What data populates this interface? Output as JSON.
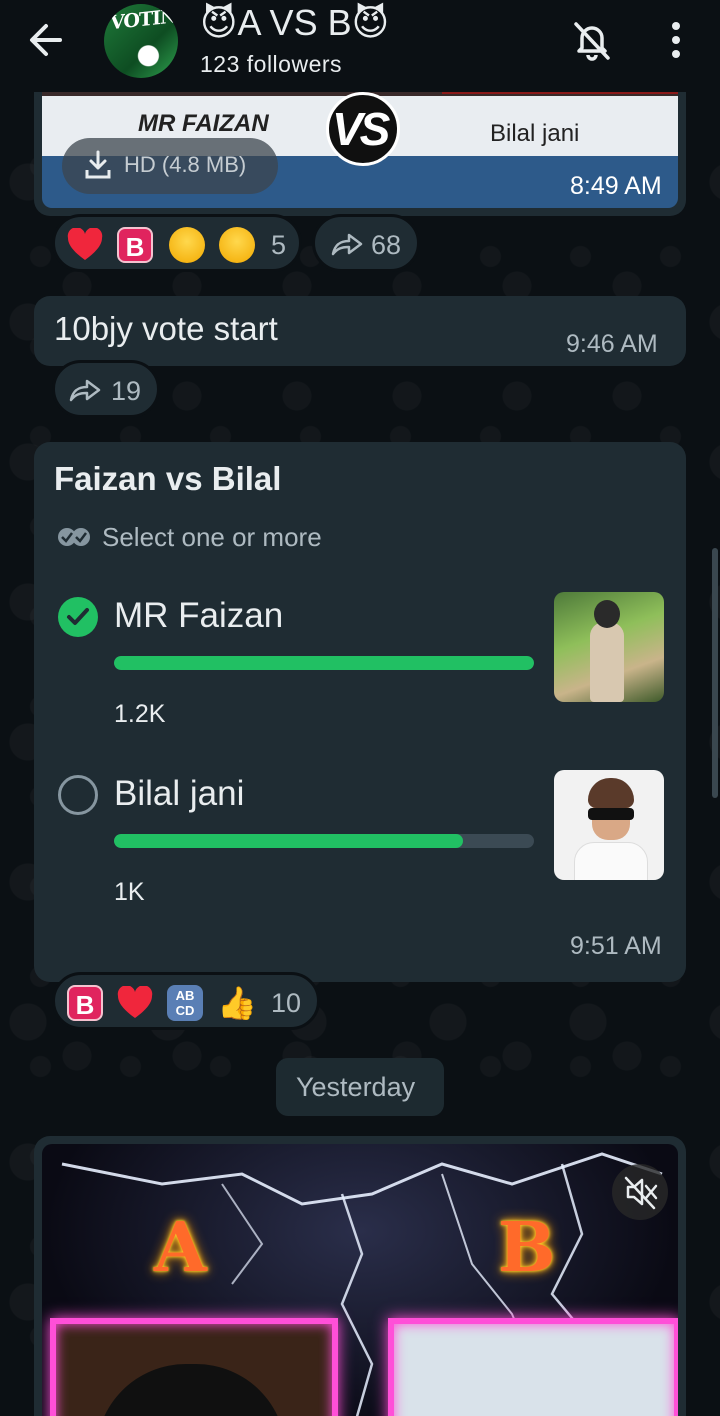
{
  "header": {
    "title": "😈A VS B😈",
    "followers": "123 followers",
    "avatar_text": "VOTING",
    "back_icon": "arrow-left-icon",
    "mute_icon": "bell-off-icon",
    "menu_icon": "more-vertical-icon"
  },
  "media_message": {
    "left_name": "MR FAIZAN",
    "vs": "VS",
    "right_name": "Bilal jani",
    "download_label": "HD (4.8 MB)",
    "time": "8:49 AM",
    "reaction_count": "5",
    "forward_count": "68"
  },
  "text_message": {
    "text": "10bjy vote start",
    "time": "9:46 AM",
    "forward_count": "19"
  },
  "poll": {
    "title": "Faizan vs Bilal",
    "subtitle": "Select one or more",
    "options": [
      {
        "label": "MR Faizan",
        "votes": "1.2K",
        "fraction": 1.0,
        "selected": true
      },
      {
        "label": "Bilal jani",
        "votes": "1K",
        "fraction": 0.83,
        "selected": false
      }
    ],
    "time": "9:51 AM",
    "reaction_count": "10",
    "reactions": [
      "🅱️",
      "❤️",
      "🔡",
      "👍"
    ]
  },
  "date_divider": "Yesterday",
  "video": {
    "letter_a": "A",
    "letter_b": "B",
    "mute_icon": "volume-mute-icon"
  },
  "colors": {
    "accent": "#21c063",
    "bubble": "#1f2c33",
    "background": "#0b1014"
  }
}
